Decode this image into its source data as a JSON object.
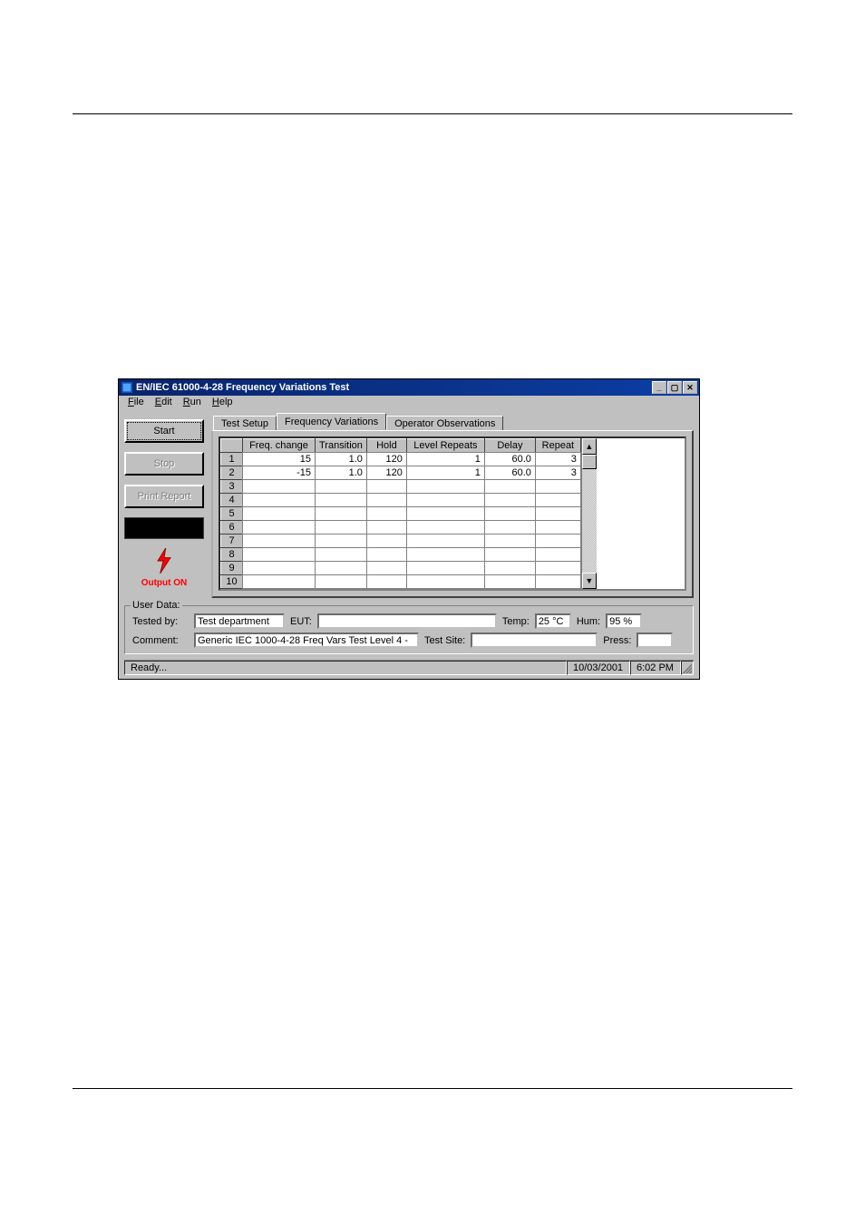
{
  "window": {
    "title": "EN/IEC 61000-4-28 Frequency Variations Test"
  },
  "menu": {
    "file": "File",
    "edit": "Edit",
    "run": "Run",
    "help": "Help"
  },
  "sidebar": {
    "start": "Start",
    "stop": "Stop",
    "print": "Print Report",
    "output_on": "Output ON"
  },
  "tabs": {
    "setup": "Test Setup",
    "freqvars": "Frequency Variations",
    "observ": "Operator Observations"
  },
  "grid": {
    "headers": {
      "freq": "Freq. change",
      "trans": "Transition",
      "hold": "Hold",
      "level": "Level Repeats",
      "delay": "Delay",
      "repeat": "Repeat"
    },
    "rows": [
      {
        "n": "1",
        "freq": "15",
        "trans": "1.0",
        "hold": "120",
        "level": "1",
        "delay": "60.0",
        "repeat": "3"
      },
      {
        "n": "2",
        "freq": "-15",
        "trans": "1.0",
        "hold": "120",
        "level": "1",
        "delay": "60.0",
        "repeat": "3"
      },
      {
        "n": "3",
        "freq": "",
        "trans": "",
        "hold": "",
        "level": "",
        "delay": "",
        "repeat": ""
      },
      {
        "n": "4",
        "freq": "",
        "trans": "",
        "hold": "",
        "level": "",
        "delay": "",
        "repeat": ""
      },
      {
        "n": "5",
        "freq": "",
        "trans": "",
        "hold": "",
        "level": "",
        "delay": "",
        "repeat": ""
      },
      {
        "n": "6",
        "freq": "",
        "trans": "",
        "hold": "",
        "level": "",
        "delay": "",
        "repeat": ""
      },
      {
        "n": "7",
        "freq": "",
        "trans": "",
        "hold": "",
        "level": "",
        "delay": "",
        "repeat": ""
      },
      {
        "n": "8",
        "freq": "",
        "trans": "",
        "hold": "",
        "level": "",
        "delay": "",
        "repeat": ""
      },
      {
        "n": "9",
        "freq": "",
        "trans": "",
        "hold": "",
        "level": "",
        "delay": "",
        "repeat": ""
      },
      {
        "n": "10",
        "freq": "",
        "trans": "",
        "hold": "",
        "level": "",
        "delay": "",
        "repeat": ""
      }
    ]
  },
  "userdata": {
    "legend": "User Data:",
    "tested_by_l": "Tested by:",
    "tested_by": "Test department",
    "eut_l": "EUT:",
    "eut": "",
    "temp_l": "Temp:",
    "temp": "25 °C",
    "hum_l": "Hum:",
    "hum": "95 %",
    "comment_l": "Comment:",
    "comment": "Generic IEC 1000-4-28 Freq Vars Test Level 4 -",
    "site_l": "Test Site:",
    "site": "",
    "press_l": "Press:",
    "press": ""
  },
  "status": {
    "ready": "Ready...",
    "date": "10/03/2001",
    "time": "6:02 PM"
  }
}
